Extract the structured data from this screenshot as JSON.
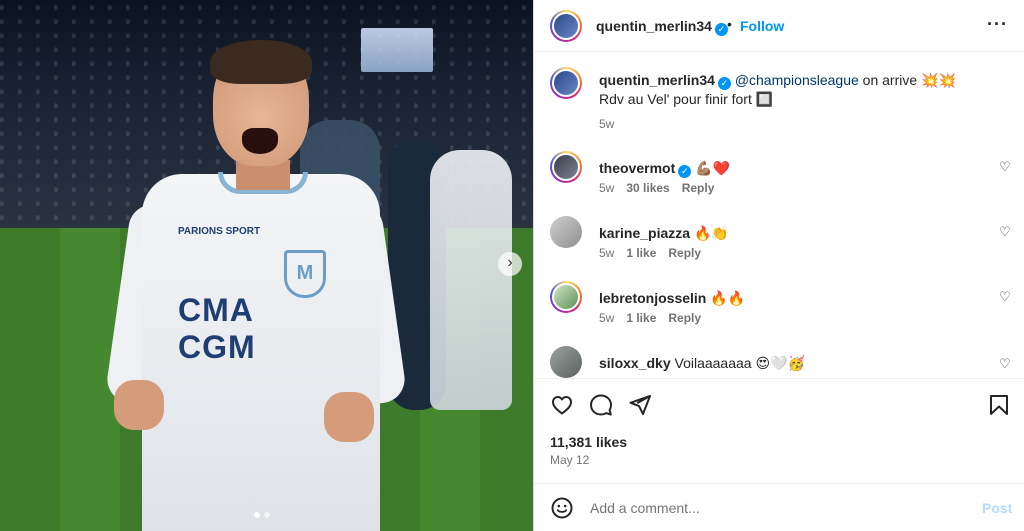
{
  "post_author": {
    "username": "quentin_merlin34",
    "follow_label": "Follow",
    "separator": "•"
  },
  "caption": {
    "username": "quentin_merlin34",
    "mention": "@championsleague",
    "text_line1": "on arrive 💥💥",
    "text_line2": "Rdv au Vel' pour finir fort 🔲",
    "time": "5w"
  },
  "comments": [
    {
      "username": "theovermot",
      "verified": true,
      "text": "💪🏽❤️",
      "time": "5w",
      "likes": "30 likes",
      "reply": "Reply"
    },
    {
      "username": "karine_piazza",
      "verified": false,
      "text": "🔥👏",
      "time": "5w",
      "likes": "1 like",
      "reply": "Reply"
    },
    {
      "username": "lebretonjosselin",
      "verified": false,
      "text": "🔥🔥",
      "time": "5w",
      "likes": "1 like",
      "reply": "Reply"
    },
    {
      "username": "siloxx_dky",
      "verified": false,
      "text": "Voilaaaaaaa 😍🤍🥳",
      "time": "",
      "likes": "",
      "reply": ""
    }
  ],
  "stats": {
    "likes": "11,381 likes",
    "date": "May 12"
  },
  "composer": {
    "placeholder": "Add a comment...",
    "post_label": "Post"
  },
  "icons": {
    "more": "more-icon",
    "like": "heart-icon",
    "comment": "comment-icon",
    "share": "share-icon",
    "save": "bookmark-icon",
    "emoji": "emoji-icon",
    "carousel_next": "chevron-right-icon"
  },
  "colors": {
    "accent": "#0095f6",
    "verified": "#0095f6",
    "post_disabled": "#b3dbff",
    "secondary_text": "#737373",
    "heart_red": "#ed4956"
  }
}
